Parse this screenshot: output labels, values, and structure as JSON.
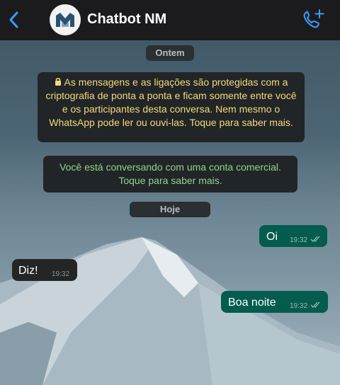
{
  "header": {
    "title": "Chatbot NM",
    "icons": {
      "back": "chevron-left-icon",
      "call": "phone-plus-icon",
      "avatar": "nm-logo"
    },
    "accent": "#3b9cf5"
  },
  "chat": {
    "date_yesterday": "Ontem",
    "encryption_notice": "As mensagens e as ligações são protegidas com a criptografia de ponta a ponta e ficam somente entre você e os participantes desta conversa. Nem mesmo o WhatsApp pode ler ou ouvi-las. Toque para saber mais.",
    "business_notice": "Você está conversando com uma conta comercial. Toque para saber mais.",
    "date_today": "Hoje",
    "messages": [
      {
        "direction": "out",
        "text": "Oi",
        "time": "19:32",
        "status": "read"
      },
      {
        "direction": "in",
        "text": "Diz!",
        "time": "19:32"
      },
      {
        "direction": "out",
        "text": "Boa noite",
        "time": "19:32",
        "status": "read"
      }
    ]
  },
  "colors": {
    "header_bg": "#1b1b1d",
    "outgoing_bubble": "#045c4f",
    "incoming_bubble": "#242626",
    "encryption_text": "#f3da7a",
    "business_text": "#8fd48c"
  }
}
